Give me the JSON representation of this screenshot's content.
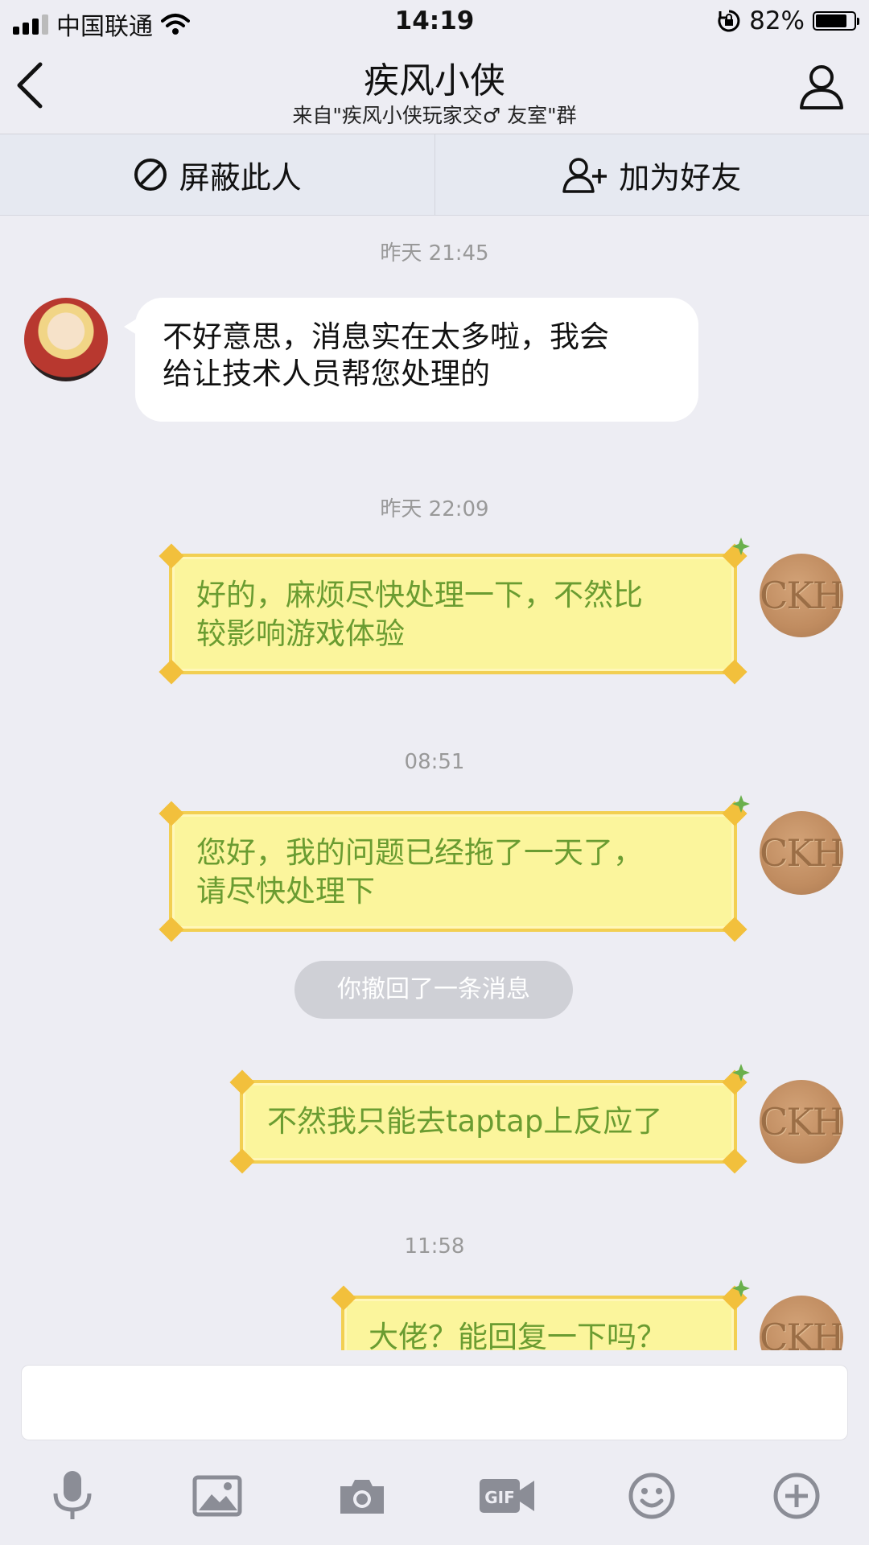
{
  "status_bar": {
    "carrier": "中国联通",
    "time": "14:19",
    "battery_text": "82%",
    "battery_level": 0.82
  },
  "header": {
    "title": "疾风小侠",
    "subtitle": "来自\"疾风小侠玩家交♂ 友室\"群"
  },
  "actions": {
    "block_label": "屏蔽此人",
    "add_friend_label": "加为好友"
  },
  "messages": [
    {
      "type": "timestamp",
      "text": "昨天 21:45"
    },
    {
      "type": "incoming",
      "lines": [
        "不好意思，消息实在太多啦，我会",
        "给让技术人员帮您处理的"
      ]
    },
    {
      "type": "timestamp",
      "text": "昨天 22:09"
    },
    {
      "type": "outgoing",
      "lines": [
        "好的，麻烦尽快处理一下，不然比",
        "较影响游戏体验"
      ]
    },
    {
      "type": "timestamp",
      "text": "08:51"
    },
    {
      "type": "outgoing",
      "lines": [
        "您好，我的问题已经拖了一天了，",
        "请尽快处理下"
      ]
    },
    {
      "type": "notice",
      "text": "你撤回了一条消息"
    },
    {
      "type": "outgoing",
      "lines": [
        "不然我只能去taptap上反应了"
      ]
    },
    {
      "type": "timestamp",
      "text": "11:58"
    },
    {
      "type": "outgoing",
      "lines": [
        "大佬？能回复一下吗？"
      ]
    }
  ],
  "my_avatar_text": "CKH",
  "input": {
    "value": ""
  },
  "toolbar_icons": [
    "microphone-icon",
    "image-icon",
    "camera-icon",
    "gif-icon",
    "emoji-icon",
    "plus-circle-icon"
  ],
  "toolbar_gif_label": "GIF",
  "colors": {
    "background": "#ededf3",
    "my_bubble_fill": "#fbf59c",
    "my_bubble_text": "#6a9c31",
    "my_bubble_border": "#f2cf52"
  }
}
